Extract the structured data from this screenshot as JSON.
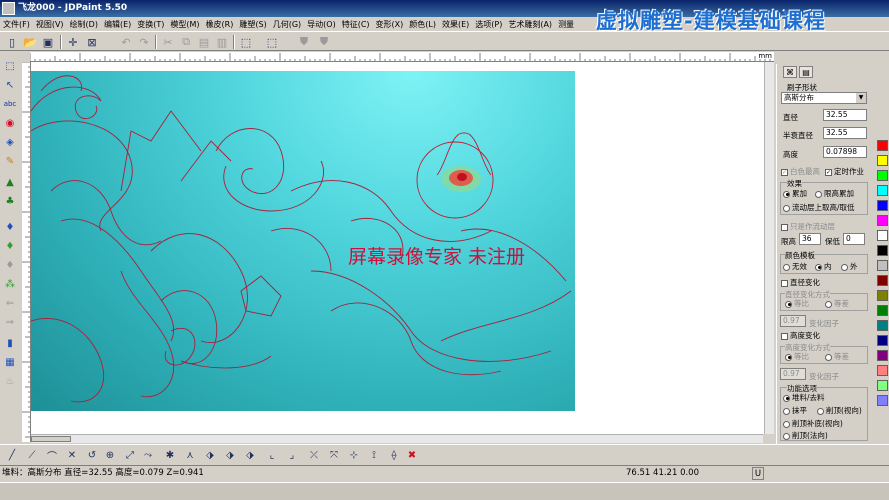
{
  "window": {
    "title": "飞龙000 - JDPaint 5.50"
  },
  "banner": {
    "text": "虚拟雕塑-建模基础课程"
  },
  "menu": [
    "文件(F)",
    "视图(V)",
    "绘制(D)",
    "编辑(E)",
    "变换(T)",
    "模型(M)",
    "橡皮(R)",
    "雕塑(S)",
    "几何(G)",
    "导动(O)",
    "特征(C)",
    "变形(X)",
    "颜色(L)",
    "效果(E)",
    "选项(P)",
    "艺术雕刻(A)",
    "测量"
  ],
  "ruler": {
    "unit": "mm"
  },
  "watermark": "屏幕录像专家 未注册",
  "panel": {
    "section_title": "刷子形状",
    "brush_shape": "高斯分布",
    "diameter_label": "直径",
    "diameter_value": "32.55",
    "half_decay_label": "半衰直径",
    "half_decay_value": "32.55",
    "height_label": "高度",
    "height_value": "0.07898",
    "white_highest_label": "白色最高",
    "timed_op_label": "定时作业",
    "effect_title": "效果",
    "effect_superpose": "累加",
    "effect_limit_superpose": "限高累加",
    "effect_flow": "流动层上取高/取低",
    "flow_only_label": "只是作流动层",
    "limit_height_label": "限高",
    "limit_height_value": "36",
    "keep_low_label": "保低",
    "keep_low_value": "0",
    "color_template_title": "颜色模板",
    "color_none": "无效",
    "color_inner": "内",
    "color_outer": "外",
    "diameter_change_label": "直径变化",
    "diameter_change_mode": "直径变化方式",
    "ratio_label": "等比",
    "diff_label": "等差",
    "change_factor_value": "0.97",
    "change_factor_label": "变化因子",
    "height_change_label": "高度变化",
    "height_change_mode": "高度变化方式",
    "height_ratio_label": "等比",
    "height_diff_label": "等差",
    "height_factor_value": "0.97",
    "height_factor_label": "变化因子",
    "function_title": "功能选项",
    "fn_pile": "堆料/去料",
    "fn_flatten": "抹平",
    "fn_cut_view": "削顶(视向)",
    "fn_cut_fill_view": "削顶补底(视向)",
    "fn_cut_normal": "削顶(法向)"
  },
  "status": {
    "left": "堆料：高斯分布  直径=32.55  高度=0.079  Z=0.941",
    "coords": "76.51  41.21  0.00",
    "unit_btn": "U"
  },
  "palette_colors": [
    "#ff0000",
    "#ffff00",
    "#00ff00",
    "#00ffff",
    "#0000ff",
    "#ff00ff",
    "#ffffff",
    "#000000",
    "#c0c0c0",
    "#800000",
    "#808000",
    "#008000",
    "#008080",
    "#000080",
    "#800080",
    "#ff8080",
    "#80ff80",
    "#8080ff"
  ]
}
